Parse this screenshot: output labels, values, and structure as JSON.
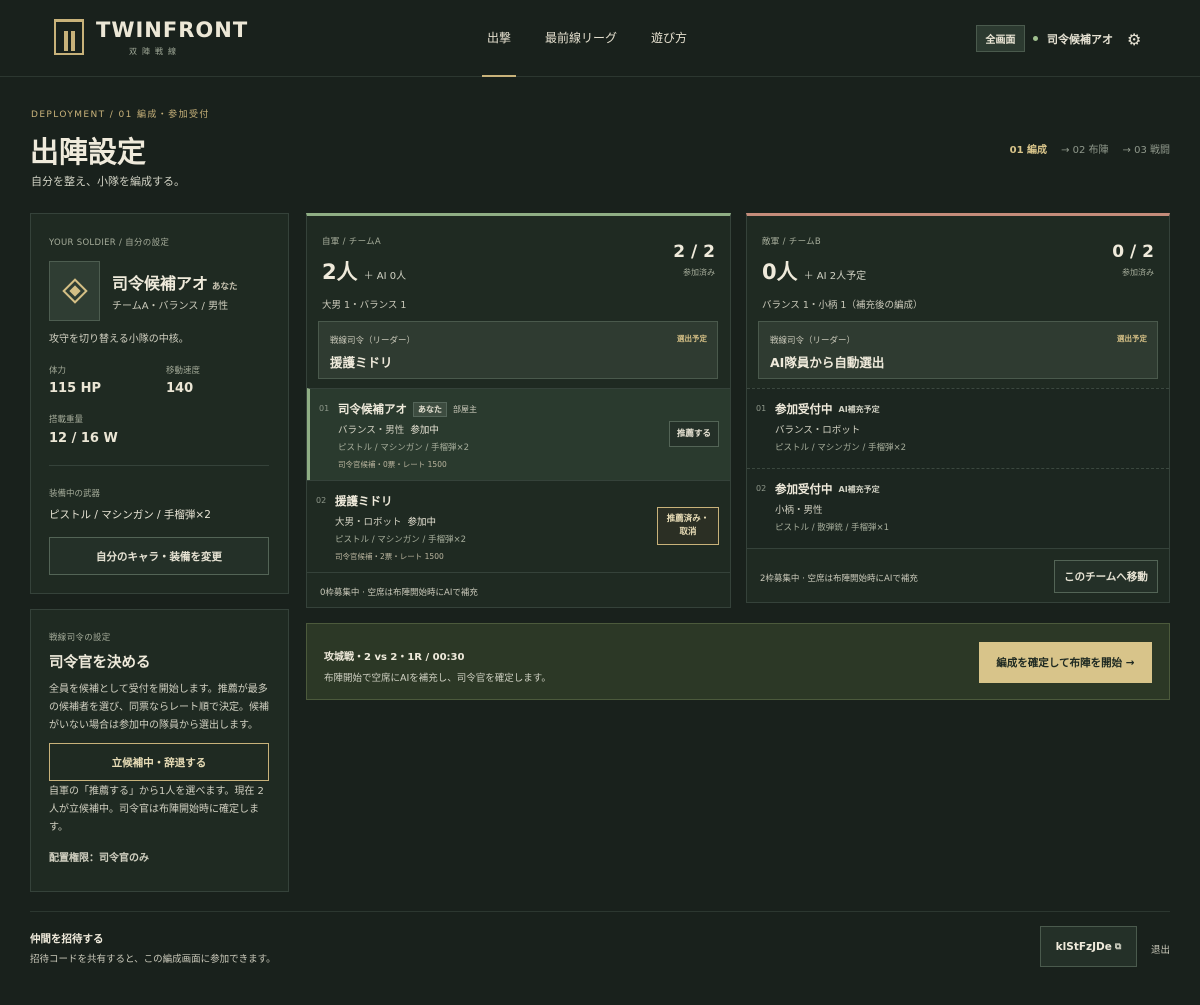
{
  "header": {
    "logo_name": "TWINFRONT",
    "logo_sub": "双陣戦線",
    "nav": [
      {
        "label": "出撃",
        "active": true
      },
      {
        "label": "最前線リーグ",
        "active": false
      },
      {
        "label": "遊び方",
        "active": false
      }
    ],
    "fullscreen_label": "全画面",
    "user_name": "司令候補アオ",
    "settings_icon": "gear-icon"
  },
  "page": {
    "breadcrumb": "DEPLOYMENT / 01 編成・参加受付",
    "title": "出陣設定",
    "subtitle": "自分を整え、小隊を編成する。",
    "steps": [
      "01 編成",
      "→ 02 布陣",
      "→ 03 戦闘"
    ]
  },
  "soldier": {
    "section": "YOUR SOLDIER / 自分の設定",
    "name": "司令候補アオ",
    "you_tag": "あなた",
    "meta": "チームA・バランス / 男性",
    "description": "攻守を切り替える小隊の中核。",
    "hp_label": "体力",
    "hp_value": "115 HP",
    "speed_label": "移動速度",
    "speed_value": "140",
    "load_label": "搭載重量",
    "load_value": "12 / 16 W",
    "weapons_label": "装備中の武器",
    "weapons_value": "ピストル / マシンガン / 手榴弾×2",
    "change_button": "自分のキャラ・装備を変更"
  },
  "commander": {
    "section": "戦線司令の設定",
    "title": "司令官を決める",
    "body": "全員を候補として受付を開始します。推薦が最多の候補者を選び、同票ならレート順で決定。候補がいない場合は参加中の隊員から選出します。",
    "button": "立候補中・辞退する",
    "note": "自軍の「推薦する」から1人を選べます。現在 2 人が立候補中。司令官は布陣開始時に確定します。",
    "permission": "配置権限：司令官のみ"
  },
  "teamA": {
    "label": "自軍 / チームA",
    "count": "2人",
    "count_sub": "＋ AI 0人",
    "ratio": "2 / 2",
    "ratio_label": "参加済み",
    "composition": "大男 1・バランス 1",
    "leader_title": "戦線司令（リーダー）",
    "leader_status": "選出予定",
    "leader_name": "援護ミドリ",
    "members": [
      {
        "num": "01",
        "name": "司令候補アオ",
        "tag": "あなた",
        "tag2": "部屋主",
        "line2": "バランス・男性",
        "state": "参加中",
        "weapons": "ピストル / マシンガン / 手榴弾×2",
        "rating": "司令官候補・0票・レート 1500",
        "button": "推薦する"
      },
      {
        "num": "02",
        "name": "援護ミドリ",
        "line2": "大男・ロボット",
        "state": "参加中",
        "weapons": "ピストル / マシンガン / 手榴弾×2",
        "rating": "司令官候補・2票・レート 1500",
        "button": "推薦済み・取消"
      }
    ],
    "footer": "0枠募集中 · 空席は布陣開始時にAIで補充"
  },
  "teamB": {
    "label": "敵軍 / チームB",
    "count": "0人",
    "count_sub": "＋ AI 2人予定",
    "ratio": "0 / 2",
    "ratio_label": "参加済み",
    "composition": "バランス 1・小柄 1（補充後の編成）",
    "leader_title": "戦線司令（リーダー）",
    "leader_status": "選出予定",
    "leader_name": "AI隊員から自動選出",
    "members": [
      {
        "num": "01",
        "name": "参加受付中",
        "tag": "AI補充予定",
        "line2": "バランス・ロボット",
        "weapons": "ピストル / マシンガン / 手榴弾×2"
      },
      {
        "num": "02",
        "name": "参加受付中",
        "tag": "AI補充予定",
        "line2": "小柄・男性",
        "weapons": "ピストル / 散弾銃 / 手榴弾×1"
      }
    ],
    "footer": "2枠募集中 · 空席は布陣開始時にAIで補充",
    "move_button": "このチームへ移動"
  },
  "battle": {
    "title": "攻城戦・2 vs 2・1R / 00:30",
    "desc": "布陣開始で空席にAIを補充し、司令官を確定します。",
    "confirm_button": "編成を確定して布陣を開始 →"
  },
  "footer": {
    "invite_title": "仲間を招待する",
    "invite_desc": "招待コードを共有すると、この編成画面に参加できます。",
    "code": "klStFzJDe",
    "copy_icon": "copy-icon",
    "exit": "退出"
  }
}
